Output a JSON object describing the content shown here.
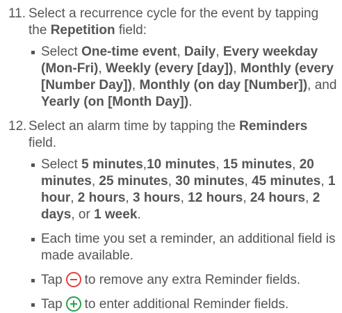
{
  "steps": [
    {
      "number": "11.",
      "text_prefix": "Select a recurrence cycle for the event by tapping the ",
      "field": "Repetition",
      "text_suffix": " field:",
      "bullets": [
        {
          "prefix": "Select ",
          "options": [
            "One-time event",
            "Daily",
            "Every weekday (Mon-Fri)",
            "Weekly (every [day])",
            "Monthly (every [Number Day])",
            "Monthly (on day [Number])",
            "Yearly (on [Month Day])"
          ],
          "sep1": ", ",
          "and_text": ", and ",
          "suffix": "."
        }
      ]
    },
    {
      "number": "12.",
      "text_prefix": "Select an alarm time by tapping the ",
      "field": "Reminders",
      "text_suffix": " field.",
      "bullets": [
        {
          "prefix": "Select ",
          "options": [
            "5 minutes",
            "10 minutes",
            "15 minutes",
            "20 minutes",
            "25 minutes",
            "30 minutes",
            "45 minutes",
            "1 hour",
            "2 hours",
            "3 hours",
            "12 hours",
            "24 hours",
            "2 days",
            "1 week"
          ],
          "or_text": "or "
        },
        {
          "text": "Each time you set a reminder, an additional field is made available."
        },
        {
          "before": "Tap",
          "icon": "minus-circle-icon",
          "after": "to remove any extra Reminder fields."
        },
        {
          "before": "Tap",
          "icon": "plus-circle-icon",
          "after": "to enter additional Reminder fields."
        }
      ]
    }
  ],
  "colors": {
    "text": "#555555",
    "minus_icon": "#e04040",
    "plus_icon": "#27a04a"
  }
}
